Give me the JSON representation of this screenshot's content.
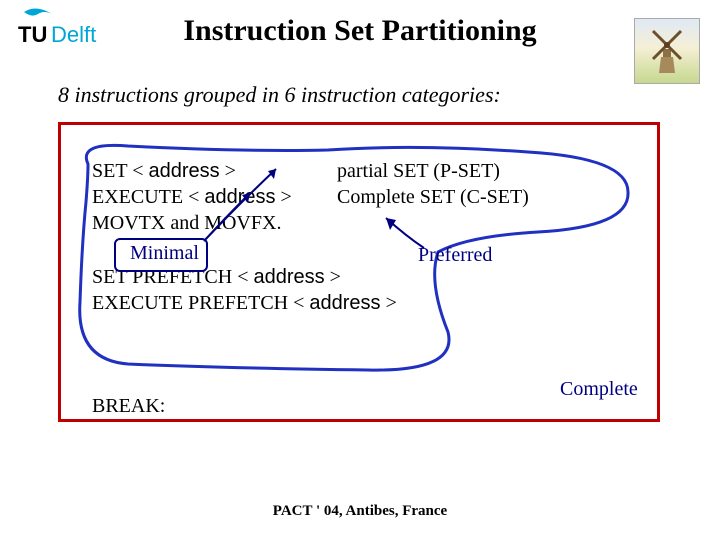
{
  "title": "Instruction Set Partitioning",
  "subtitle": "8 instructions grouped in 6 instruction categories:",
  "left": {
    "l1a": "SET < ",
    "l1b": "address",
    "l1c": " >",
    "l2a": "EXECUTE < ",
    "l2b": "address",
    "l2c": " >",
    "l3": "MOVTX and MOVFX."
  },
  "right": {
    "r1": "partial SET (P-SET)",
    "r2": "Complete SET (C-SET)"
  },
  "mid": {
    "m1a": "SET PREFETCH < ",
    "m1b": "address",
    "m1c": " >",
    "m2a": "EXECUTE PREFETCH < ",
    "m2b": "address",
    "m2c": " >"
  },
  "labels": {
    "minimal": "Minimal",
    "preferred": "Preferred",
    "complete": "Complete",
    "break": "BREAK:"
  },
  "footer": "PACT ' 04, Antibes, France",
  "logo": {
    "tu": "TU",
    "delft": "Delft"
  }
}
